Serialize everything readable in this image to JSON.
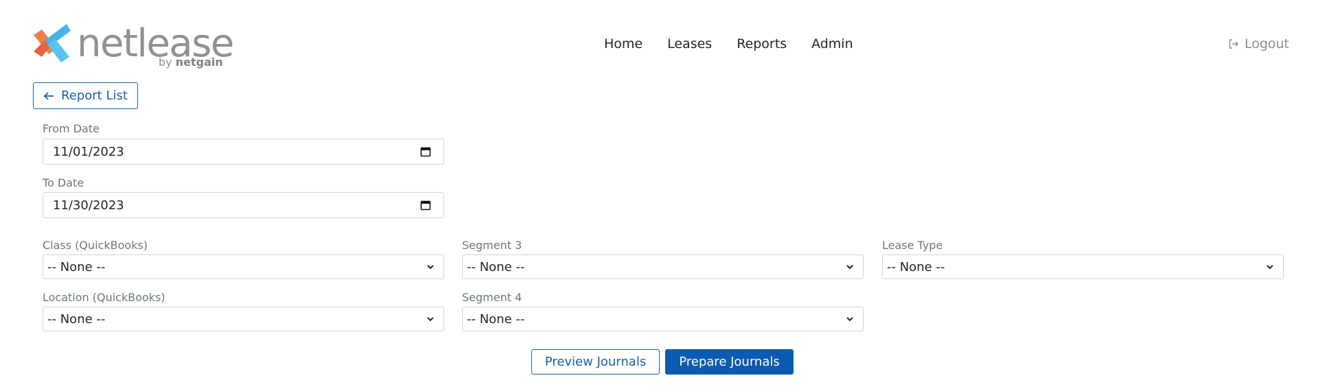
{
  "brand": {
    "name": "netlease",
    "sub_prefix": "by",
    "sub_company": "netgain"
  },
  "nav": {
    "items": [
      {
        "label": "Home"
      },
      {
        "label": "Leases"
      },
      {
        "label": "Reports"
      },
      {
        "label": "Admin"
      }
    ],
    "logout_label": "Logout"
  },
  "back_button": {
    "label": "Report List"
  },
  "form": {
    "from_date": {
      "label": "From Date",
      "value": "11/01/2023"
    },
    "to_date": {
      "label": "To Date",
      "value": "11/30/2023"
    },
    "class_qb": {
      "label": "Class (QuickBooks)",
      "value": "-- None --"
    },
    "segment3": {
      "label": "Segment 3",
      "value": "-- None --"
    },
    "lease_type": {
      "label": "Lease Type",
      "value": "-- None --"
    },
    "location_qb": {
      "label": "Location (QuickBooks)",
      "value": "-- None --"
    },
    "segment4": {
      "label": "Segment 4",
      "value": "-- None --"
    }
  },
  "actions": {
    "preview_label": "Preview Journals",
    "prepare_label": "Prepare Journals"
  },
  "colors": {
    "primary": "#0d5bb0",
    "outline": "#1a5fa8",
    "logo_orange": "#f07f4a",
    "logo_blue": "#41b6e6",
    "muted_text": "#6c757d"
  }
}
